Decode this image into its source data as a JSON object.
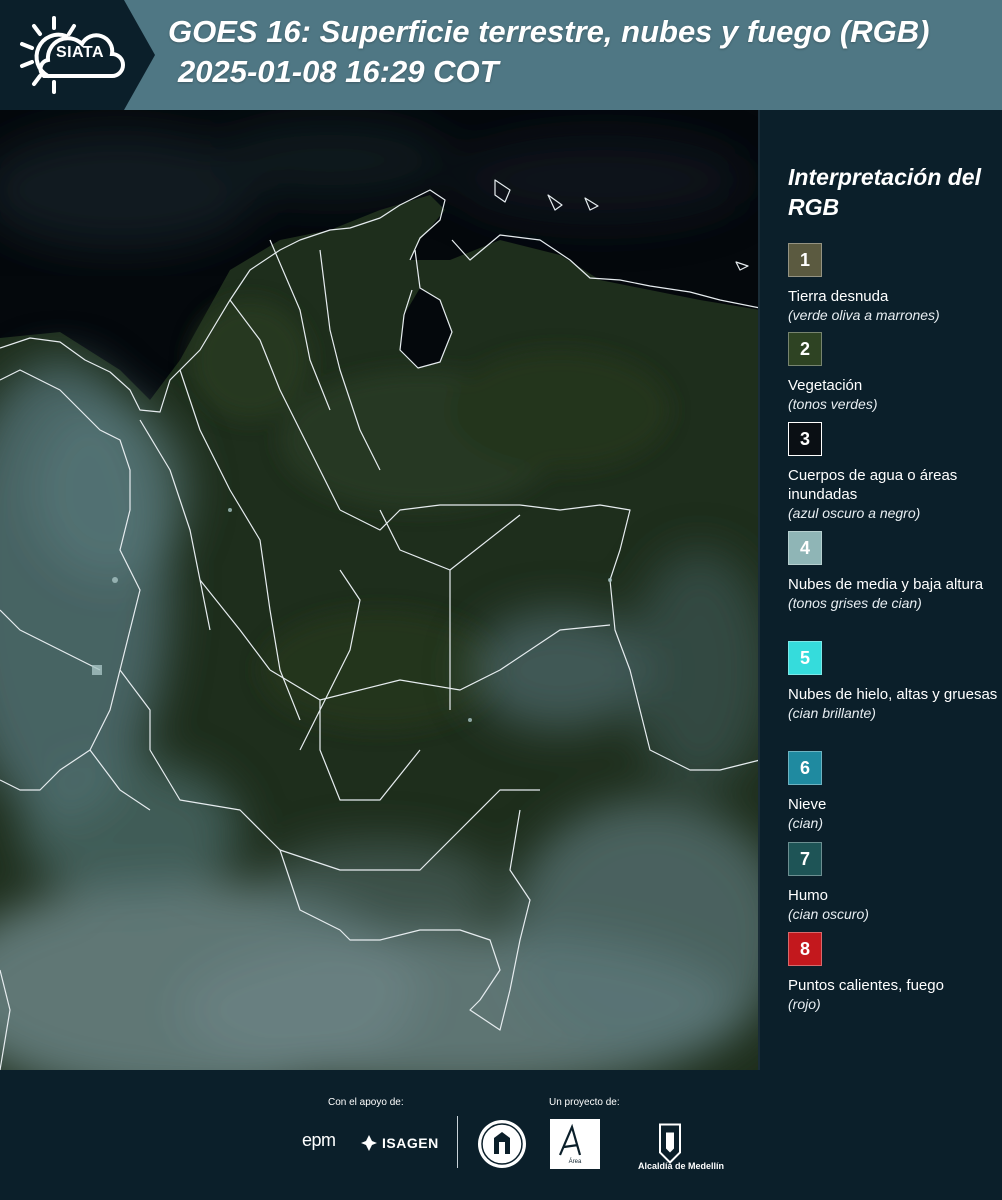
{
  "header": {
    "logo_text": "SIATA",
    "title_line1": "GOES 16: Superficie terrestre, nubes y fuego (RGB)",
    "title_line2": "2025-01-08 16:29 COT"
  },
  "legend": {
    "title": "Interpretación del RGB",
    "items": [
      {
        "number": "1",
        "label": "Tierra desnuda",
        "desc": "(verde oliva a marrones)",
        "color": "#5b5a40"
      },
      {
        "number": "2",
        "label": "Vegetación",
        "desc": "(tonos verdes)",
        "color": "#2e4323"
      },
      {
        "number": "3",
        "label": "Cuerpos de agua o áreas inundadas",
        "desc": "(azul oscuro a negro)",
        "color": "#0a0f14"
      },
      {
        "number": "4",
        "label": "Nubes de media y baja altura",
        "desc": "(tonos grises de cian)",
        "color": "#8fb5b6"
      },
      {
        "number": "5",
        "label": "Nubes de hielo, altas y gruesas",
        "desc": "(cian brillante)",
        "color": "#35dcdc"
      },
      {
        "number": "6",
        "label": "Nieve",
        "desc": "(cian)",
        "color": "#1f8aa0"
      },
      {
        "number": "7",
        "label": "Humo",
        "desc": "(cian oscuro)",
        "color": "#1e5456"
      },
      {
        "number": "8",
        "label": "Puntos calientes, fuego",
        "desc": "(rojo)",
        "color": "#c3181d"
      }
    ]
  },
  "footer": {
    "support_label": "Con el apoyo de:",
    "project_label": "Un proyecto de:",
    "epm_logo": "epm",
    "isagen_logo": "ISAGEN",
    "amva_logo": "Área",
    "medellin_logo": "Alcaldía de Medellín"
  }
}
